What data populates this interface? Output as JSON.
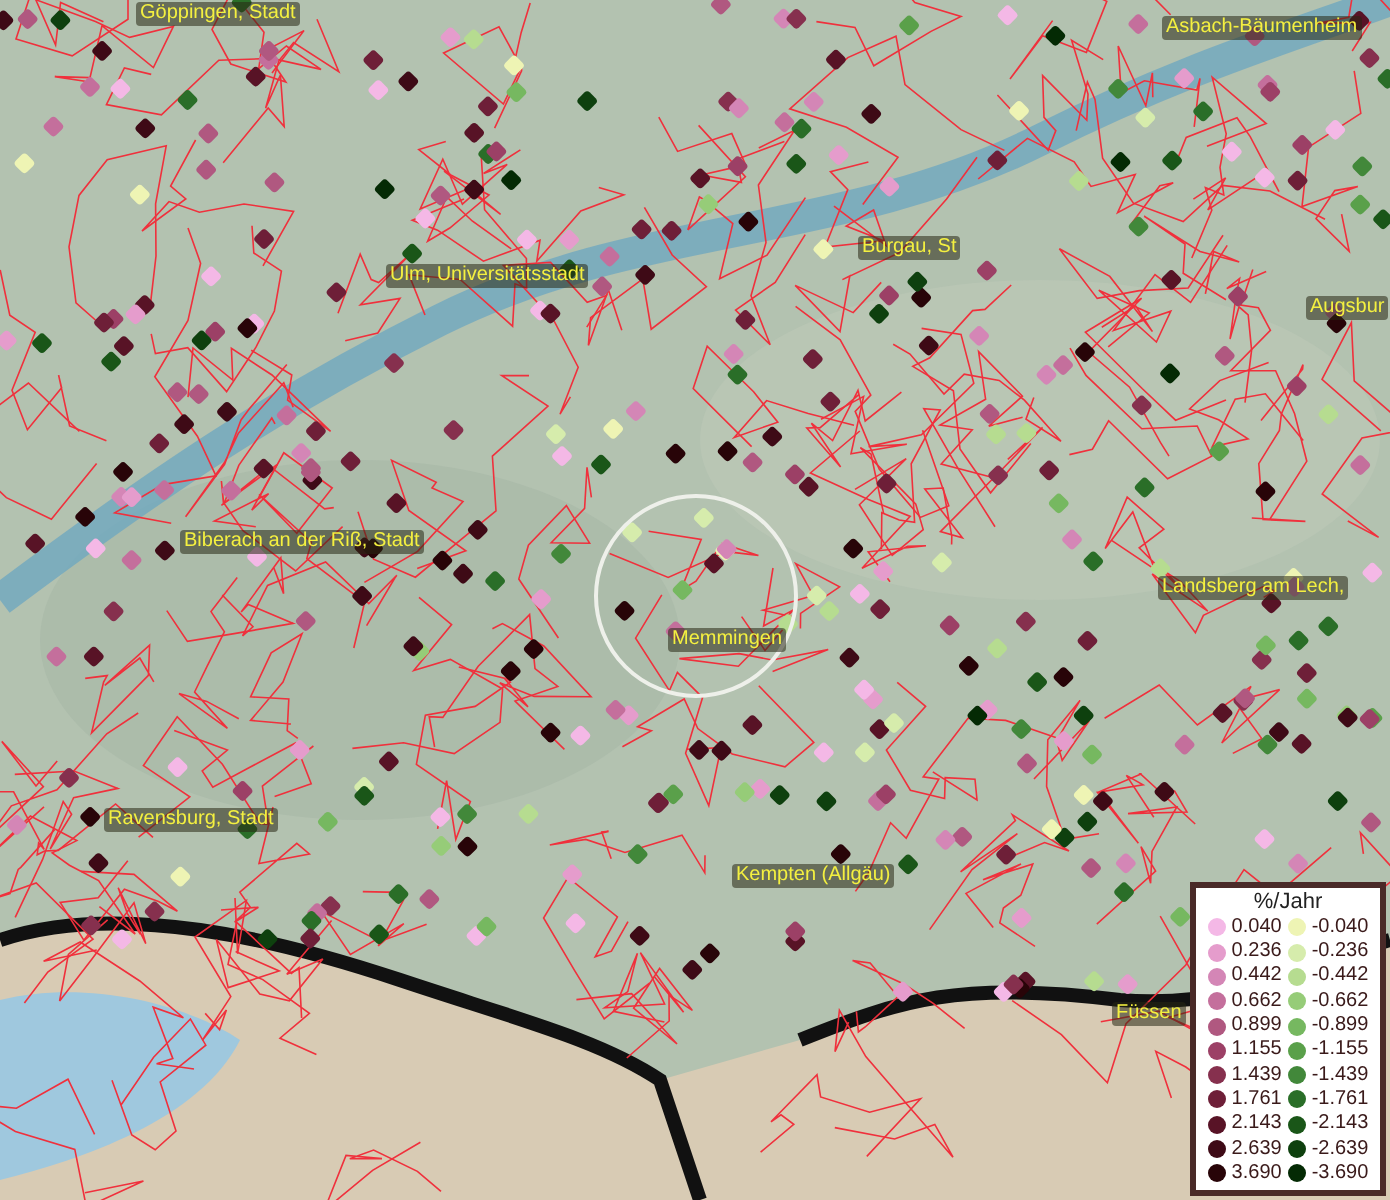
{
  "map": {
    "labels": [
      {
        "text": "Göppingen, Stadt"
      },
      {
        "text": "Asbach-Bäumenheim"
      },
      {
        "text": "Burgau, St"
      },
      {
        "text": "Ulm, Universitätsstadt"
      },
      {
        "text": "Augsbur"
      },
      {
        "text": "Biberach an der Riß, Stadt"
      },
      {
        "text": "Landsberg am Lech,"
      },
      {
        "text": "Memmingen"
      },
      {
        "text": "Ravensburg, Stadt"
      },
      {
        "text": "Kempten (Allgäu)"
      },
      {
        "text": "Füssen"
      }
    ]
  },
  "legend": {
    "title": "%/Jahr",
    "rows": [
      {
        "left": {
          "value": "0.040",
          "color": "#f4b8e6"
        },
        "right": {
          "value": "-0.040",
          "color": "#eef4b4"
        }
      },
      {
        "left": {
          "value": "0.236",
          "color": "#e59ccc"
        },
        "right": {
          "value": "-0.236",
          "color": "#d6ecac"
        }
      },
      {
        "left": {
          "value": "0.442",
          "color": "#d486b6"
        },
        "right": {
          "value": "-0.442",
          "color": "#b6dc90"
        }
      },
      {
        "left": {
          "value": "0.662",
          "color": "#c46f9c"
        },
        "right": {
          "value": "-0.662",
          "color": "#96cc78"
        }
      },
      {
        "left": {
          "value": "0.899",
          "color": "#b05880"
        },
        "right": {
          "value": "-0.899",
          "color": "#76b860"
        }
      },
      {
        "left": {
          "value": "1.155",
          "color": "#9c4066"
        },
        "right": {
          "value": "-1.155",
          "color": "#5aa04a"
        }
      },
      {
        "left": {
          "value": "1.439",
          "color": "#86304e"
        },
        "right": {
          "value": "-1.439",
          "color": "#42883a"
        }
      },
      {
        "left": {
          "value": "1.761",
          "color": "#6e1f38"
        },
        "right": {
          "value": "-1.761",
          "color": "#2a6e28"
        }
      },
      {
        "left": {
          "value": "2.143",
          "color": "#581326"
        },
        "right": {
          "value": "-2.143",
          "color": "#1a5618"
        }
      },
      {
        "left": {
          "value": "2.639",
          "color": "#3e0a16"
        },
        "right": {
          "value": "-2.639",
          "color": "#0e400e"
        }
      },
      {
        "left": {
          "value": "3.690",
          "color": "#280408"
        },
        "right": {
          "value": "-3.690",
          "color": "#042a04"
        }
      }
    ]
  }
}
